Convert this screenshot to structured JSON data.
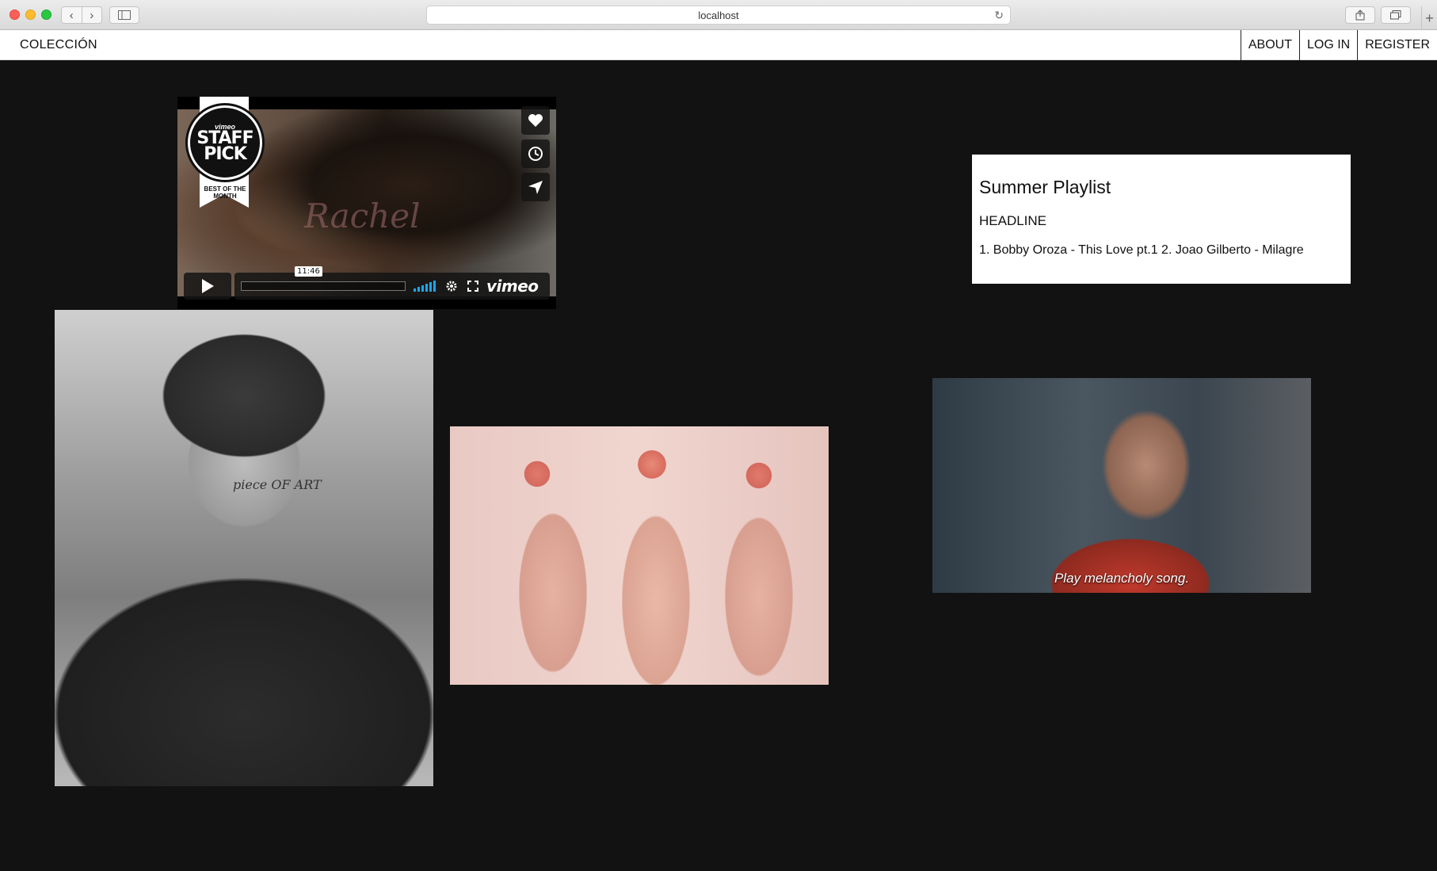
{
  "browser": {
    "url": "localhost"
  },
  "nav": {
    "brand": "COLECCIÓN",
    "links": [
      "ABOUT",
      "LOG IN",
      "REGISTER"
    ]
  },
  "video": {
    "badge_brand": "vimeo",
    "badge_line1": "STAFF",
    "badge_line2": "PICK",
    "badge_sub": "BEST OF THE MONTH",
    "title_overlay": "Rachel",
    "timecode": "11:46",
    "logo": "vimeo",
    "side_icons": [
      "heart-icon",
      "clock-icon",
      "send-icon"
    ]
  },
  "playlist_card": {
    "title": "Summer Playlist",
    "headline": "HEADLINE",
    "body": "1. Bobby Oroza - This Love pt.1 2. Joao Gilberto - Milagre"
  },
  "photos": {
    "portrait_tattoo": "piece OF ART",
    "film_subtitle": "Play melancholy song."
  },
  "colors": {
    "background": "#121212",
    "card": "#ffffff",
    "volume_accent": "#1aa7ec"
  }
}
